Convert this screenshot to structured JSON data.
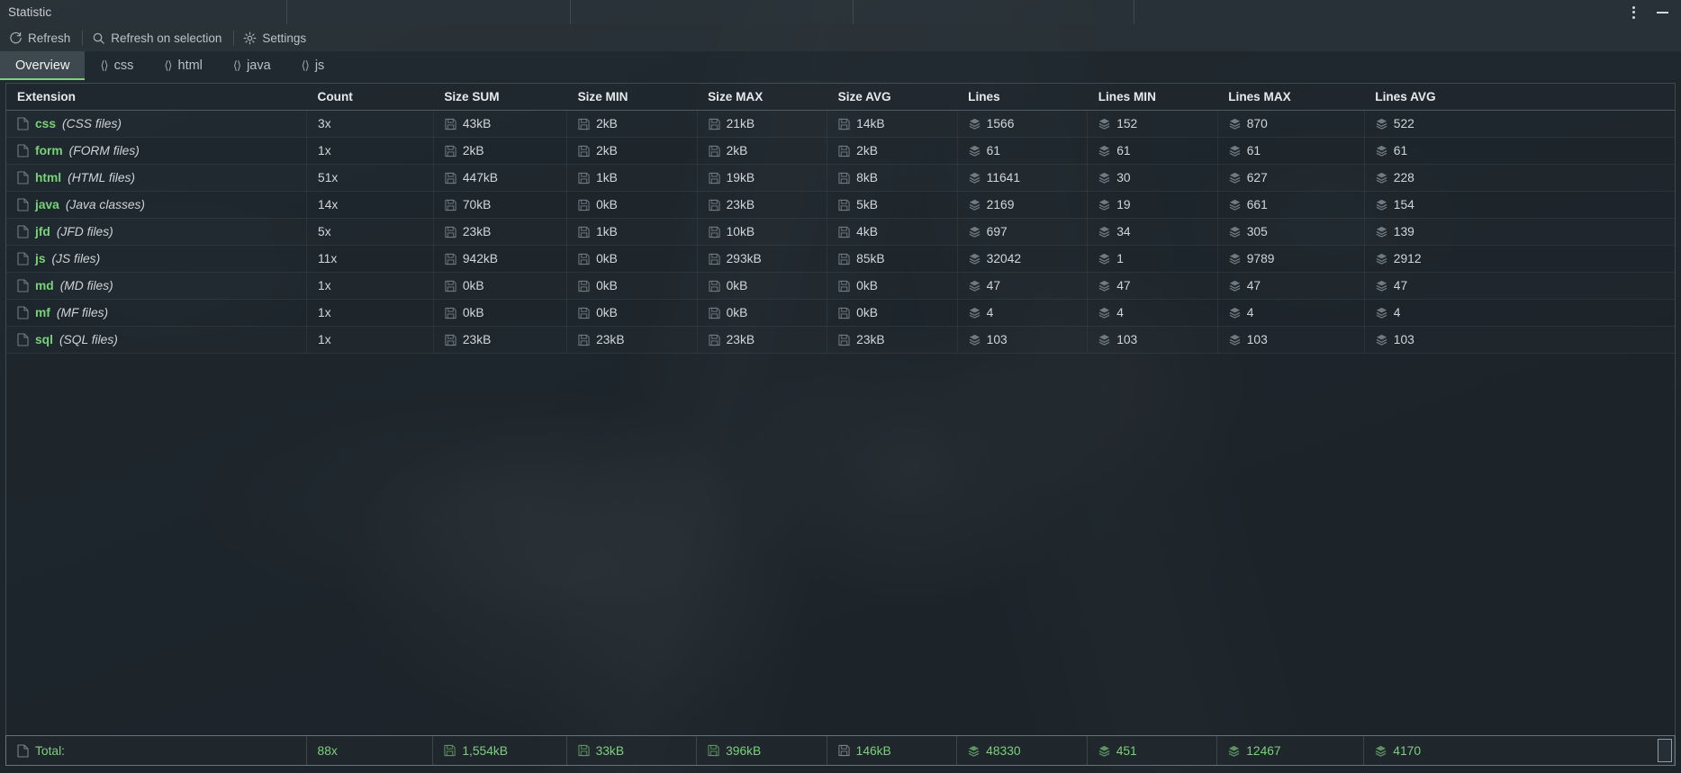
{
  "window": {
    "title": "Statistic",
    "controls": [
      {
        "name": "more-options",
        "icon": "vertical-ellipsis-icon"
      },
      {
        "name": "minimize",
        "icon": "minimize-icon"
      }
    ]
  },
  "toolbar": {
    "items": [
      {
        "label": "Refresh",
        "icon": "refresh-icon"
      },
      {
        "label": "Refresh on selection",
        "icon": "search-icon"
      },
      {
        "label": "Settings",
        "icon": "gear-icon"
      }
    ]
  },
  "tabs": [
    {
      "label": "Overview",
      "icon": null,
      "active": true
    },
    {
      "label": "css",
      "icon": "code-icon",
      "active": false
    },
    {
      "label": "html",
      "icon": "code-icon",
      "active": false
    },
    {
      "label": "java",
      "icon": "code-icon",
      "active": false
    },
    {
      "label": "js",
      "icon": "code-icon",
      "active": false
    }
  ],
  "table": {
    "columns": [
      "Extension",
      "Count",
      "Size SUM",
      "Size MIN",
      "Size MAX",
      "Size AVG",
      "Lines",
      "Lines MIN",
      "Lines MAX",
      "Lines AVG"
    ],
    "rows": [
      {
        "ext": "css",
        "desc": "(CSS files)",
        "count": "3x",
        "size_sum": "43kB",
        "size_min": "2kB",
        "size_max": "21kB",
        "size_avg": "14kB",
        "lines": "1566",
        "lines_min": "152",
        "lines_max": "870",
        "lines_avg": "522"
      },
      {
        "ext": "form",
        "desc": "(FORM files)",
        "count": "1x",
        "size_sum": "2kB",
        "size_min": "2kB",
        "size_max": "2kB",
        "size_avg": "2kB",
        "lines": "61",
        "lines_min": "61",
        "lines_max": "61",
        "lines_avg": "61"
      },
      {
        "ext": "html",
        "desc": "(HTML files)",
        "count": "51x",
        "size_sum": "447kB",
        "size_min": "1kB",
        "size_max": "19kB",
        "size_avg": "8kB",
        "lines": "11641",
        "lines_min": "30",
        "lines_max": "627",
        "lines_avg": "228"
      },
      {
        "ext": "java",
        "desc": "(Java classes)",
        "count": "14x",
        "size_sum": "70kB",
        "size_min": "0kB",
        "size_max": "23kB",
        "size_avg": "5kB",
        "lines": "2169",
        "lines_min": "19",
        "lines_max": "661",
        "lines_avg": "154"
      },
      {
        "ext": "jfd",
        "desc": "(JFD files)",
        "count": "5x",
        "size_sum": "23kB",
        "size_min": "1kB",
        "size_max": "10kB",
        "size_avg": "4kB",
        "lines": "697",
        "lines_min": "34",
        "lines_max": "305",
        "lines_avg": "139"
      },
      {
        "ext": "js",
        "desc": "(JS files)",
        "count": "11x",
        "size_sum": "942kB",
        "size_min": "0kB",
        "size_max": "293kB",
        "size_avg": "85kB",
        "lines": "32042",
        "lines_min": "1",
        "lines_max": "9789",
        "lines_avg": "2912"
      },
      {
        "ext": "md",
        "desc": "(MD files)",
        "count": "1x",
        "size_sum": "0kB",
        "size_min": "0kB",
        "size_max": "0kB",
        "size_avg": "0kB",
        "lines": "47",
        "lines_min": "47",
        "lines_max": "47",
        "lines_avg": "47"
      },
      {
        "ext": "mf",
        "desc": "(MF files)",
        "count": "1x",
        "size_sum": "0kB",
        "size_min": "0kB",
        "size_max": "0kB",
        "size_avg": "0kB",
        "lines": "4",
        "lines_min": "4",
        "lines_max": "4",
        "lines_avg": "4"
      },
      {
        "ext": "sql",
        "desc": "(SQL files)",
        "count": "1x",
        "size_sum": "23kB",
        "size_min": "23kB",
        "size_max": "23kB",
        "size_avg": "23kB",
        "lines": "103",
        "lines_min": "103",
        "lines_max": "103",
        "lines_avg": "103"
      }
    ]
  },
  "totals": {
    "label": "Total:",
    "count": "88x",
    "size_sum": "1,554kB",
    "size_min": "33kB",
    "size_max": "396kB",
    "size_avg": "146kB",
    "lines": "48330",
    "lines_min": "451",
    "lines_max": "12467",
    "lines_avg": "4170"
  },
  "colors": {
    "accent_green": "#7ed07e",
    "text_primary": "#cfd7dc",
    "header_text": "#e4eaee",
    "panel_bg": "#222b32"
  }
}
